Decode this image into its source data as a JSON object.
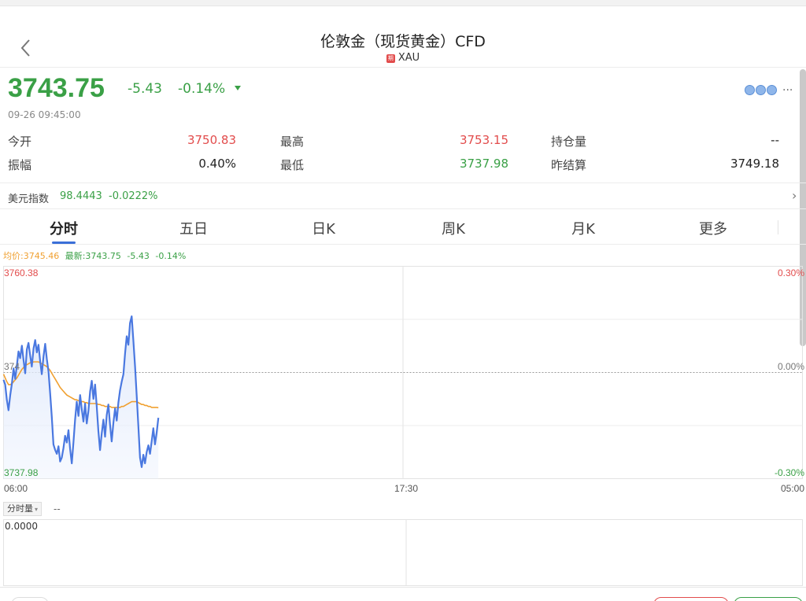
{
  "header": {
    "title": "伦敦金（现货黄金）CFD",
    "tag_glyph": "期",
    "symbol": "XAU"
  },
  "quote": {
    "price": "3743.75",
    "change": "-5.43",
    "change_pct": "-0.14%",
    "timestamp": "09-26 09:45:00",
    "more_glyph": "···",
    "stats": [
      {
        "label": "今开",
        "value": "3750.83",
        "color": "red"
      },
      {
        "label": "最高",
        "value": "3753.15",
        "color": "red"
      },
      {
        "label": "持仓量",
        "value": "--",
        "color": "dark"
      },
      {
        "label": "振幅",
        "value": "0.40%",
        "color": "dark"
      },
      {
        "label": "最低",
        "value": "3737.98",
        "color": "green"
      },
      {
        "label": "昨结算",
        "value": "3749.18",
        "color": "dark"
      }
    ]
  },
  "dxy": {
    "name": "美元指数",
    "value": "98.4443",
    "change_pct": "-0.0222%",
    "chevron": "›"
  },
  "tabs": [
    "分时",
    "五日",
    "日K",
    "周K",
    "月K",
    "更多"
  ],
  "legend": {
    "avg": "均价:3745.46",
    "latest": "最新:3743.75",
    "change": "-5.43",
    "change_pct": "-0.14%"
  },
  "chart_data": {
    "type": "line",
    "y_top_label": "3760.38",
    "y_mid_label": "374",
    "y_bottom_label": "3737.98",
    "pct_top_label": "0.30%",
    "pct_mid_label": "0.00%",
    "pct_bottom_label": "-0.30%",
    "x_labels": [
      "06:00",
      "17:30",
      "05:00"
    ],
    "ylim": [
      3737.98,
      3760.38
    ],
    "prev_close": 3749.18,
    "total_points": 480,
    "series": [
      {
        "name": "最新",
        "color": "#4a78e0",
        "values": [
          3748.4,
          3747.9,
          3746.3,
          3745.2,
          3746.8,
          3748.0,
          3749.6,
          3748.5,
          3749.9,
          3751.4,
          3750.7,
          3752.0,
          3750.5,
          3749.1,
          3751.6,
          3752.3,
          3751.0,
          3749.8,
          3751.7,
          3752.6,
          3751.3,
          3752.1,
          3750.4,
          3749.0,
          3750.9,
          3752.2,
          3750.6,
          3749.3,
          3747.0,
          3744.5,
          3741.6,
          3741.0,
          3740.6,
          3741.4,
          3739.8,
          3740.2,
          3741.2,
          3742.5,
          3741.8,
          3743.1,
          3741.1,
          3739.6,
          3741.8,
          3744.2,
          3746.1,
          3744.6,
          3746.8,
          3745.3,
          3744.0,
          3745.9,
          3743.8,
          3745.1,
          3747.2,
          3748.3,
          3746.4,
          3747.9,
          3745.6,
          3743.0,
          3741.0,
          3742.8,
          3744.2,
          3742.4,
          3744.7,
          3745.8,
          3743.7,
          3741.9,
          3743.9,
          3745.4,
          3744.1,
          3746.0,
          3747.3,
          3748.2,
          3749.0,
          3751.2,
          3753.0,
          3752.1,
          3754.4,
          3755.1,
          3752.6,
          3749.8,
          3746.7,
          3743.5,
          3740.2,
          3739.2,
          3740.5,
          3739.6,
          3740.8,
          3741.5,
          3740.6,
          3741.9,
          3743.3,
          3741.6,
          3742.8,
          3744.4
        ]
      },
      {
        "name": "均价",
        "color": "#f0a030",
        "values": [
          3749.0,
          3748.6,
          3748.2,
          3747.9,
          3747.9,
          3748.0,
          3748.2,
          3748.4,
          3748.6,
          3748.9,
          3749.2,
          3749.5,
          3749.7,
          3749.9,
          3750.0,
          3750.1,
          3750.2,
          3750.2,
          3750.3,
          3750.3,
          3750.3,
          3750.3,
          3750.2,
          3750.1,
          3750.0,
          3749.9,
          3749.8,
          3749.6,
          3749.4,
          3749.1,
          3748.8,
          3748.5,
          3748.2,
          3747.9,
          3747.6,
          3747.4,
          3747.2,
          3747.0,
          3746.8,
          3746.7,
          3746.6,
          3746.5,
          3746.4,
          3746.3,
          3746.3,
          3746.2,
          3746.2,
          3746.1,
          3746.1,
          3746.0,
          3746.0,
          3745.9,
          3745.9,
          3745.9,
          3745.9,
          3745.9,
          3745.9,
          3745.8,
          3745.8,
          3745.7,
          3745.7,
          3745.6,
          3745.6,
          3745.6,
          3745.6,
          3745.5,
          3745.5,
          3745.5,
          3745.5,
          3745.5,
          3745.5,
          3745.6,
          3745.6,
          3745.7,
          3745.8,
          3745.9,
          3746.0,
          3746.1,
          3746.1,
          3746.1,
          3746.1,
          3746.0,
          3745.9,
          3745.8,
          3745.8,
          3745.7,
          3745.7,
          3745.6,
          3745.6,
          3745.5,
          3745.5,
          3745.5,
          3745.5,
          3745.46
        ]
      }
    ]
  },
  "volume": {
    "selector_label": "分时量",
    "caret": "▾",
    "value": "--",
    "axis_label": "0.0000"
  }
}
